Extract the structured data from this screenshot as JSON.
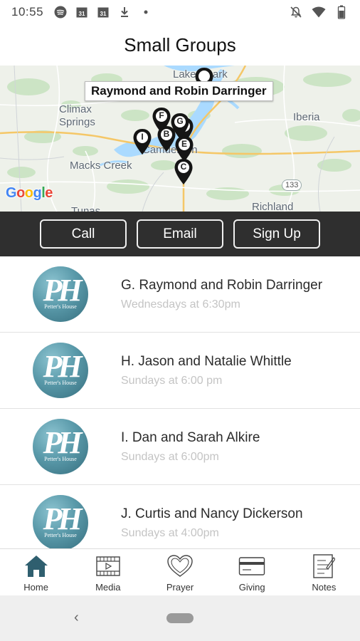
{
  "status_bar": {
    "time": "10:55",
    "left_icons": [
      "spotify-icon",
      "calendar-icon",
      "calendar-icon",
      "download-icon",
      "dot-icon"
    ],
    "calendar_day": "31",
    "right_icons": [
      "notifications-off-icon",
      "wifi-icon",
      "battery-icon"
    ]
  },
  "header": {
    "title": "Small Groups"
  },
  "map": {
    "callout": "Raymond and Robin Darringer",
    "labels": {
      "lake": "Lake Ozark",
      "climax": "Climax\nSprings",
      "iberia": "Iberia",
      "macks": "Macks Creek",
      "camdenton": "Camdenton",
      "richland": "Richland",
      "tunas": "Tunas"
    },
    "highway_badge": "133",
    "google_logo": "Google",
    "pins": [
      "F",
      "G",
      "B",
      "E",
      "I",
      "C"
    ]
  },
  "actions": {
    "call": "Call",
    "email": "Email",
    "signup": "Sign Up"
  },
  "groups": [
    {
      "name": "G. Raymond and Robin Darringer",
      "time": "Wednesdays at 6:30pm",
      "logo_text": "PH",
      "logo_caption": "Petter's House"
    },
    {
      "name": "H. Jason and Natalie Whittle",
      "time": "Sundays at 6:00 pm",
      "logo_text": "PH",
      "logo_caption": "Petter's House"
    },
    {
      "name": "I. Dan and Sarah Alkire",
      "time": "Sundays at 6:00pm",
      "logo_text": "PH",
      "logo_caption": "Petter's House"
    },
    {
      "name": "J. Curtis and Nancy Dickerson",
      "time": "Sundays at 4:00pm",
      "logo_text": "PH",
      "logo_caption": "Petter's House"
    }
  ],
  "bottom_nav": [
    {
      "label": "Home",
      "icon": "home-icon",
      "active": true
    },
    {
      "label": "Media",
      "icon": "film-icon",
      "active": false
    },
    {
      "label": "Prayer",
      "icon": "heart-icon",
      "active": false
    },
    {
      "label": "Giving",
      "icon": "credit-card-icon",
      "active": false
    },
    {
      "label": "Notes",
      "icon": "notes-icon",
      "active": false
    }
  ],
  "colors": {
    "accent_teal": "#2f5f6f",
    "action_bar": "#2f2f2f",
    "muted_text": "#c4c4c4"
  },
  "system_nav": {
    "back_glyph": "‹"
  }
}
